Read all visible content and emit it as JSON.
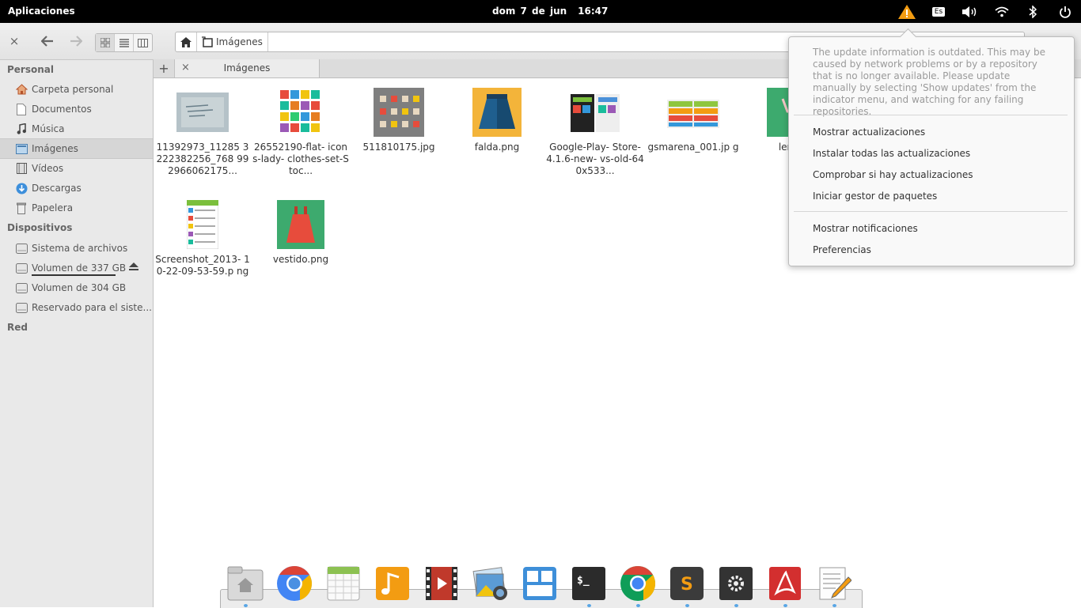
{
  "panel": {
    "apps_label": "Aplicaciones",
    "date": "dom  7 de jun",
    "time": "16:47",
    "keyboard_layout": "Es"
  },
  "toolbar": {
    "close_label": "×",
    "back_label": "←",
    "forward_label": "→"
  },
  "path": {
    "crumb": "Imágenes"
  },
  "sidebar": {
    "sections": {
      "personal": "Personal",
      "devices": "Dispositivos",
      "network": "Red"
    },
    "personal_items": [
      {
        "label": "Carpeta personal",
        "icon": "home-icon"
      },
      {
        "label": "Documentos",
        "icon": "document-icon"
      },
      {
        "label": "Música",
        "icon": "music-icon"
      },
      {
        "label": "Imágenes",
        "icon": "pictures-icon"
      },
      {
        "label": "Vídeos",
        "icon": "video-icon"
      },
      {
        "label": "Descargas",
        "icon": "download-icon"
      },
      {
        "label": "Papelera",
        "icon": "trash-icon"
      }
    ],
    "device_items": [
      {
        "label": "Sistema de archivos",
        "icon": "drive-icon"
      },
      {
        "label": "Volumen de 337 GB",
        "icon": "drive-icon"
      },
      {
        "label": "Volumen de 304 GB",
        "icon": "drive-icon"
      },
      {
        "label": "Reservado para el siste...",
        "icon": "drive-icon"
      }
    ]
  },
  "tabs": {
    "new_label": "+",
    "close_label": "×",
    "label": "Imágenes"
  },
  "files": [
    {
      "name": "11392973_11285 3222382256_768 992966062175..."
    },
    {
      "name": "26552190-flat- icons-lady- clothes-set-Stoc..."
    },
    {
      "name": "511810175.jpg"
    },
    {
      "name": "falda.png"
    },
    {
      "name": "Google-Play- Store-4.1.6-new- vs-old-640x533..."
    },
    {
      "name": "gsmarena_001.jp g"
    },
    {
      "name": "lence"
    },
    {
      "name": "Screenshot_2013- 10-22-09-53-59.p ng"
    },
    {
      "name": "vestido.png"
    }
  ],
  "update_popup": {
    "message": "The update information is outdated. This may be caused by network problems or by a repository that is no longer available. Please update manually by selecting 'Show updates' from the indicator menu, and watching for any failing repositories.",
    "items": [
      "Mostrar actualizaciones",
      "Instalar todas las actualizaciones",
      "Comprobar si hay actualizaciones",
      "Iniciar gestor de paquetes",
      "Mostrar notificaciones",
      "Preferencias"
    ]
  },
  "dock": [
    {
      "icon": "files-icon"
    },
    {
      "icon": "chromium-icon"
    },
    {
      "icon": "calendar-icon"
    },
    {
      "icon": "music-player-icon"
    },
    {
      "icon": "video-player-icon"
    },
    {
      "icon": "photos-icon"
    },
    {
      "icon": "workspaces-icon"
    },
    {
      "icon": "terminal-icon"
    },
    {
      "icon": "chrome-icon"
    },
    {
      "icon": "sublime-text-icon"
    },
    {
      "icon": "settings-icon"
    },
    {
      "icon": "pdf-viewer-icon"
    },
    {
      "icon": "text-editor-icon"
    }
  ],
  "colors": {
    "panel_bg": "#000000",
    "sidebar_bg": "#e9e9e9",
    "warning": "#f39c12",
    "dock_indicator": "#59a6e5"
  }
}
